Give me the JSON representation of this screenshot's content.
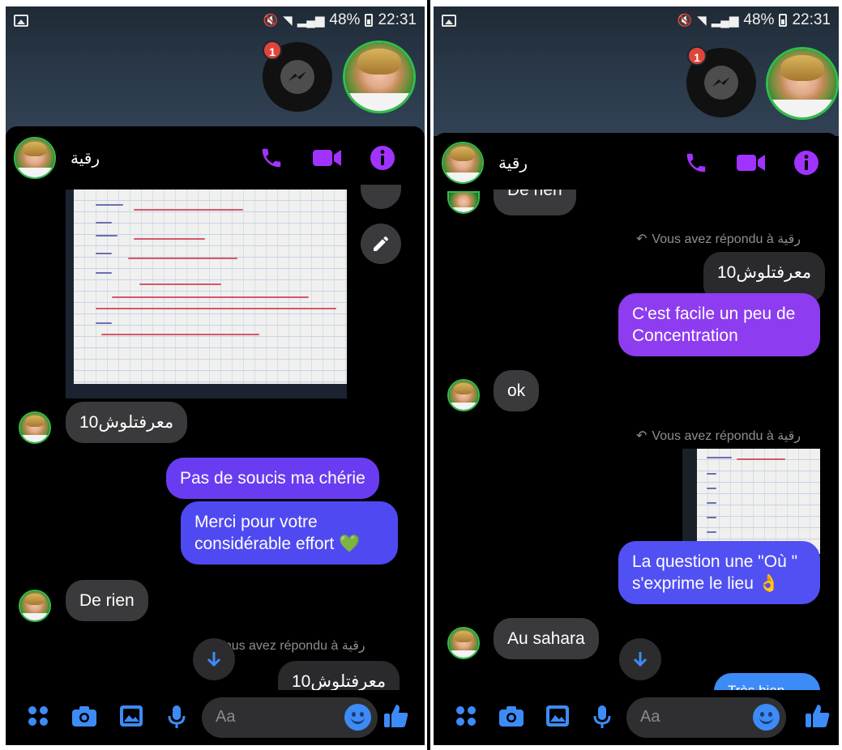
{
  "colors": {
    "accent": "#a033ff",
    "outgoing_bubble_top": "#8e3cf0",
    "outgoing_bubble_bottom": "#4a4cf0",
    "incoming_bubble": "#3a3a3c",
    "badge": "#e0453a",
    "like_blue": "#3d8bf7"
  },
  "screens": [
    {
      "status": {
        "battery": "48%",
        "time": "22:31"
      },
      "chathead_badge": "1",
      "contact": {
        "name": "رقية"
      },
      "messages": {
        "in_10": "10معرفتلوش",
        "out_1": "Pas de soucis ma chérie",
        "out_2": "Merci pour votre considérable effort",
        "out_2_emoji": "💚",
        "in_de_rien": "De rien",
        "reply_note": "Vous avez répondu à رقية",
        "reply_quote": "10معرفتلوش"
      },
      "composer": {
        "placeholder": "Aa"
      }
    },
    {
      "status": {
        "battery": "48%",
        "time": "22:31"
      },
      "chathead_badge": "1",
      "contact": {
        "name": "رقية"
      },
      "messages": {
        "partial_top": "De rien",
        "reply_note_1": "Vous avez répondu à رقية",
        "reply_quote_1": "10معرفتلوش",
        "out_1": "C'est facile un peu de Concentration",
        "in_ok": "ok",
        "reply_note_2": "Vous avez répondu à رقية",
        "out_2": "La question une \"Où \" s'exprime le lieu",
        "out_2_emoji": "👌",
        "in_sahara": "Au sahara",
        "partial_bottom": "Très bien"
      },
      "composer": {
        "placeholder": "Aa"
      }
    }
  ]
}
